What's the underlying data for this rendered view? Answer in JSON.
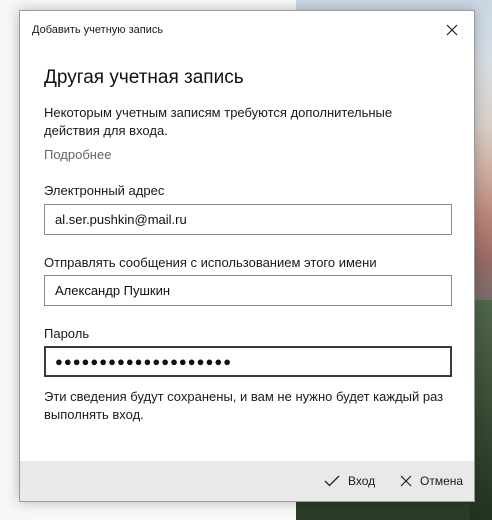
{
  "dialog": {
    "window_title": "Добавить учетную запись",
    "heading": "Другая учетная запись",
    "description": "Некоторым учетным записям требуются дополнительные действия для входа.",
    "more_link": "Подробнее",
    "email": {
      "label": "Электронный адрес",
      "value": "al.ser.pushkin@mail.ru"
    },
    "display_name": {
      "label": "Отправлять сообщения с использованием этого имени",
      "value": "Александр Пушкин"
    },
    "password": {
      "label": "Пароль",
      "value": "●●●●●●●●●●●●●●●●●●●●"
    },
    "note": "Эти сведения будут сохранены, и вам не нужно будет каждый раз выполнять вход.",
    "footer": {
      "signin_label": "Вход",
      "cancel_label": "Отмена"
    }
  },
  "icons": {
    "close": "close-icon",
    "signin": "checkmark-icon",
    "cancel": "cancel-icon"
  }
}
